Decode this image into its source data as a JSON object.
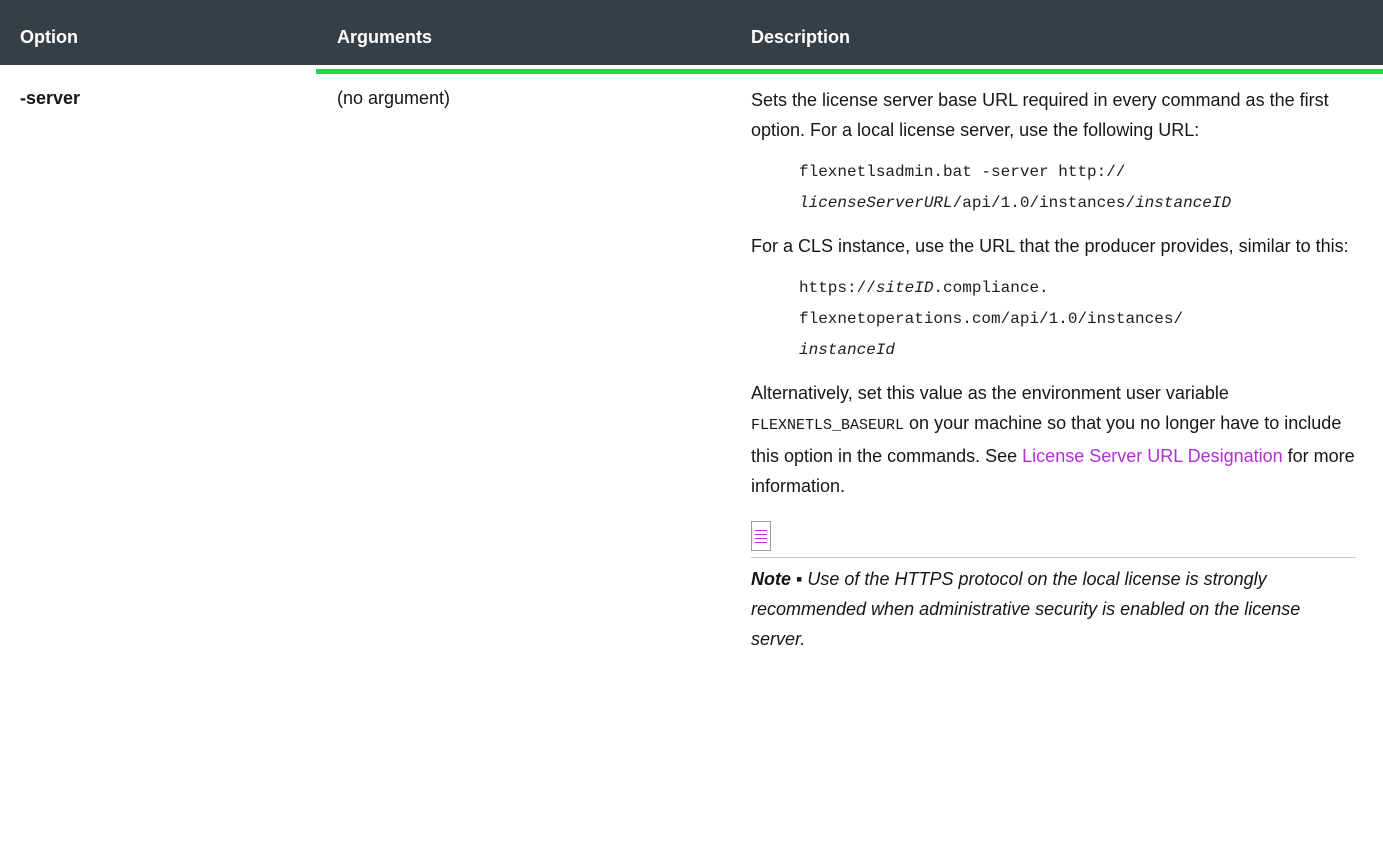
{
  "table": {
    "headers": {
      "option": "Option",
      "arguments": "Arguments",
      "description": "Description"
    },
    "row": {
      "option": "-server",
      "arguments": "(no argument)",
      "description": {
        "para1": "Sets the license server base URL required in every command as the first option. For a local license server, use the following URL:",
        "code1": {
          "line1": "flexnetlsadmin.bat -server http://",
          "line2_italic": "licenseServerURL",
          "line2_mid": "/api/1.0/instances/",
          "line2_italic_end": "instanceID"
        },
        "para2": "For a CLS instance, use the URL that the producer provides, similar to this:",
        "code2": {
          "line1_pre": "https://",
          "line1_italic": "siteID",
          "line1_post": ".compliance.",
          "line2": "flexnetoperations.com/api/1.0/instances/",
          "line3_italic": "instanceId"
        },
        "para3_pre": "Alternatively, set this value as the environment user variable",
        "para3_code": "FLEXNETLS_BASEURL",
        "para3_mid": "on your machine so that you no longer have to include this option in the commands. See",
        "para3_link": "License Server URL Designation",
        "para3_post": "for more information.",
        "note_label": "Note ▪",
        "note_text": "Use of the HTTPS protocol on the local license is strongly recommended when administrative security is enabled on the license server."
      }
    }
  },
  "colors": {
    "header_bg": "#363f46",
    "accent_bar": "#2bd14e",
    "link": "#b32ed6"
  }
}
